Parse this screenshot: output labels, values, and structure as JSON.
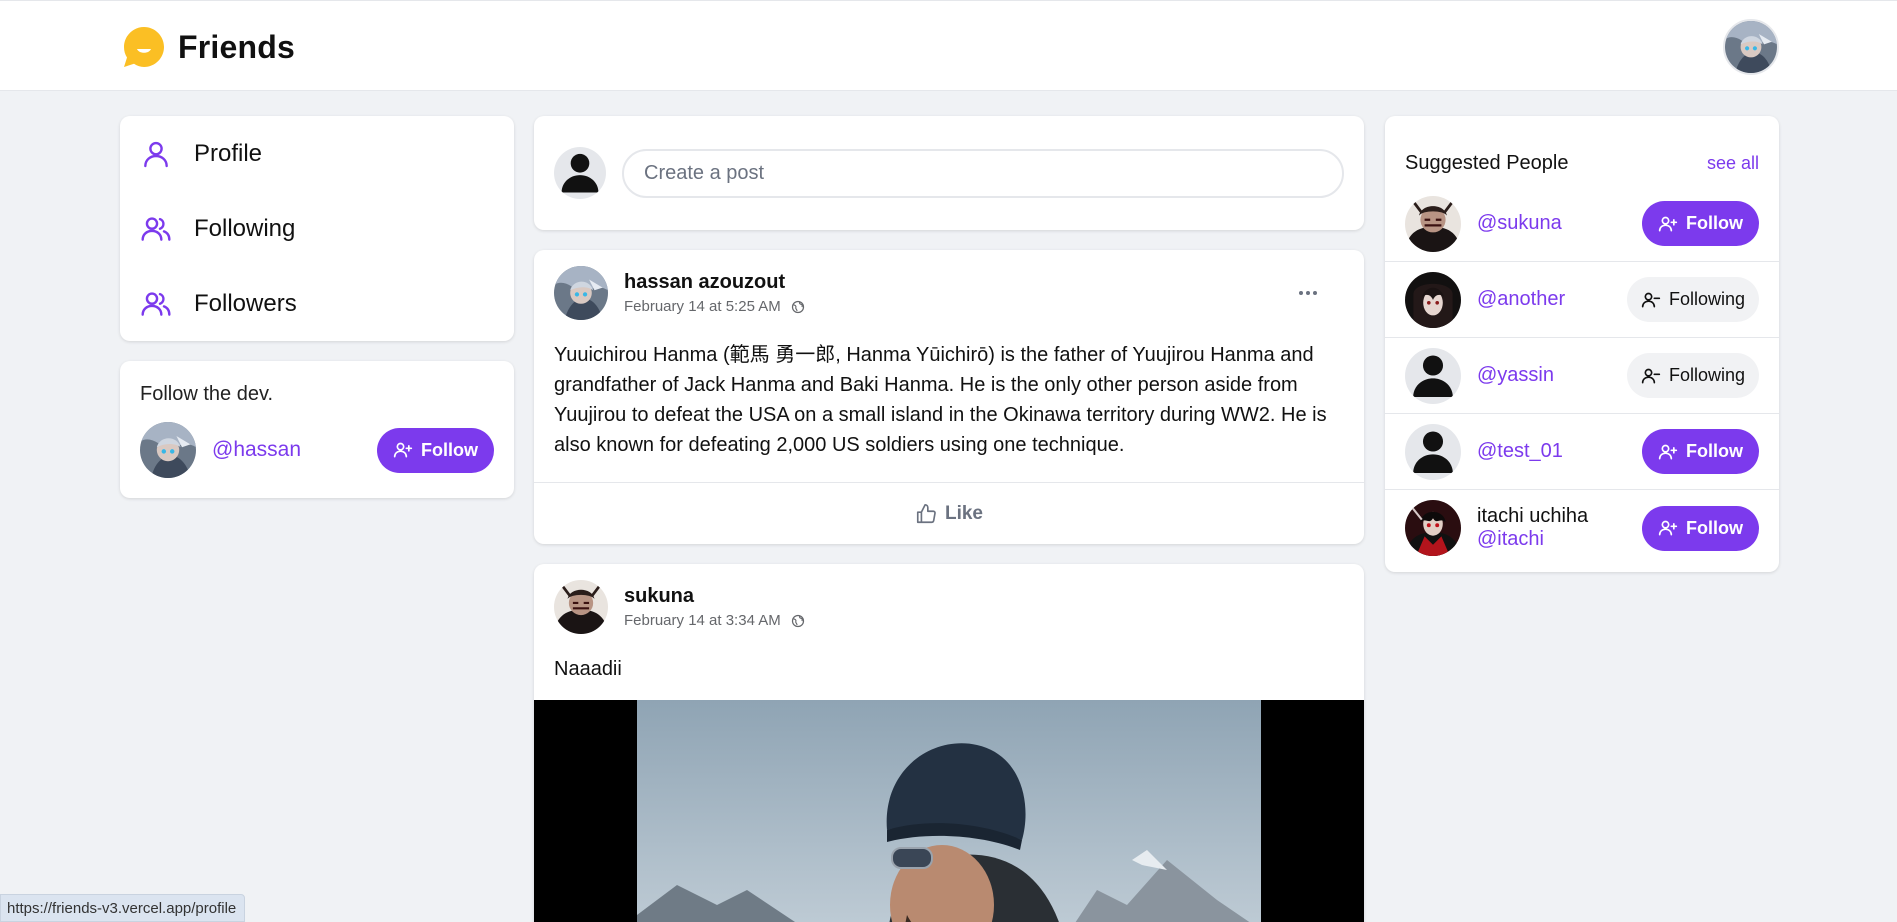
{
  "header": {
    "app_name": "Friends"
  },
  "nav": {
    "items": [
      {
        "label": "Profile",
        "icon": "user-icon"
      },
      {
        "label": "Following",
        "icon": "users-icon"
      },
      {
        "label": "Followers",
        "icon": "users-icon"
      }
    ]
  },
  "dev": {
    "title": "Follow the dev.",
    "handle": "@hassan",
    "button": "Follow"
  },
  "create_post": {
    "placeholder": "Create a post"
  },
  "posts": [
    {
      "author": "hassan azouzout",
      "time": "February 14 at 5:25 AM",
      "text": "Yuuichirou Hanma (範馬 勇一郎, Hanma Yūichirō) is the father of Yuujirou Hanma and grandfather of Jack Hanma and Baki Hanma. He is the only other person aside from Yuujirou to defeat the USA on a small island in the Okinawa territory during WW2. He is also known for defeating 2,000 US soldiers using one technique.",
      "like_label": "Like"
    },
    {
      "author": "sukuna",
      "time": "February 14 at 3:34 AM",
      "text": "Naaadii"
    }
  ],
  "suggested": {
    "title": "Suggested People",
    "see_all": "see all",
    "people": [
      {
        "name": "",
        "handle": "@sukuna",
        "button": "Follow"
      },
      {
        "name": "",
        "handle": "@another",
        "button": "Following"
      },
      {
        "name": "",
        "handle": "@yassin",
        "button": "Following"
      },
      {
        "name": "",
        "handle": "@test_01",
        "button": "Follow"
      },
      {
        "name": "itachi uchiha",
        "handle": "@itachi",
        "button": "Follow"
      }
    ]
  },
  "status_bar": {
    "url": "https://friends-v3.vercel.app/profile"
  },
  "colors": {
    "accent": "#7c3aed",
    "background": "#f0f2f5",
    "logo": "#fbbf24"
  }
}
